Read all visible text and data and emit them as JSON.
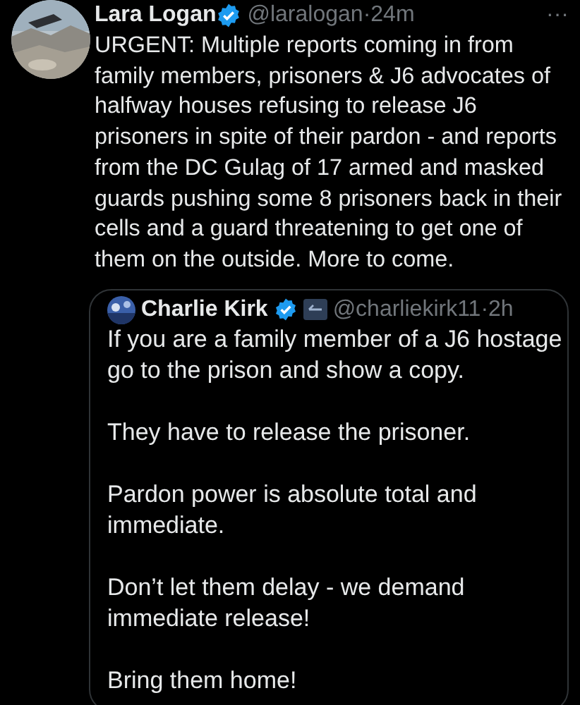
{
  "post": {
    "author": "Lara Logan",
    "verified": true,
    "handle": "@laralogan",
    "separator": "·",
    "time": "24m",
    "more": "···",
    "text": "URGENT: Multiple reports coming in from family members, prisoners & J6 advocates of halfway houses refusing to release J6 prisoners in spite of their pardon - and reports from the DC Gulag of 17 armed and masked guards pushing some 8 prisoners back in their cells and a guard threatening to get one of them on the outside. More to come.",
    "quote": {
      "author": "Charlie Kirk",
      "verified": true,
      "affiliated": true,
      "handle": "@charliekirk11",
      "separator": "·",
      "time": "2h",
      "paragraphs": [
        "If you are a family member of a J6 hostage go to the prison and show a copy.",
        "They have to release the prisoner.",
        "Pardon power is absolute total and immediate.",
        "Don’t let them delay - we demand immediate release!",
        "Bring them home!"
      ]
    }
  }
}
